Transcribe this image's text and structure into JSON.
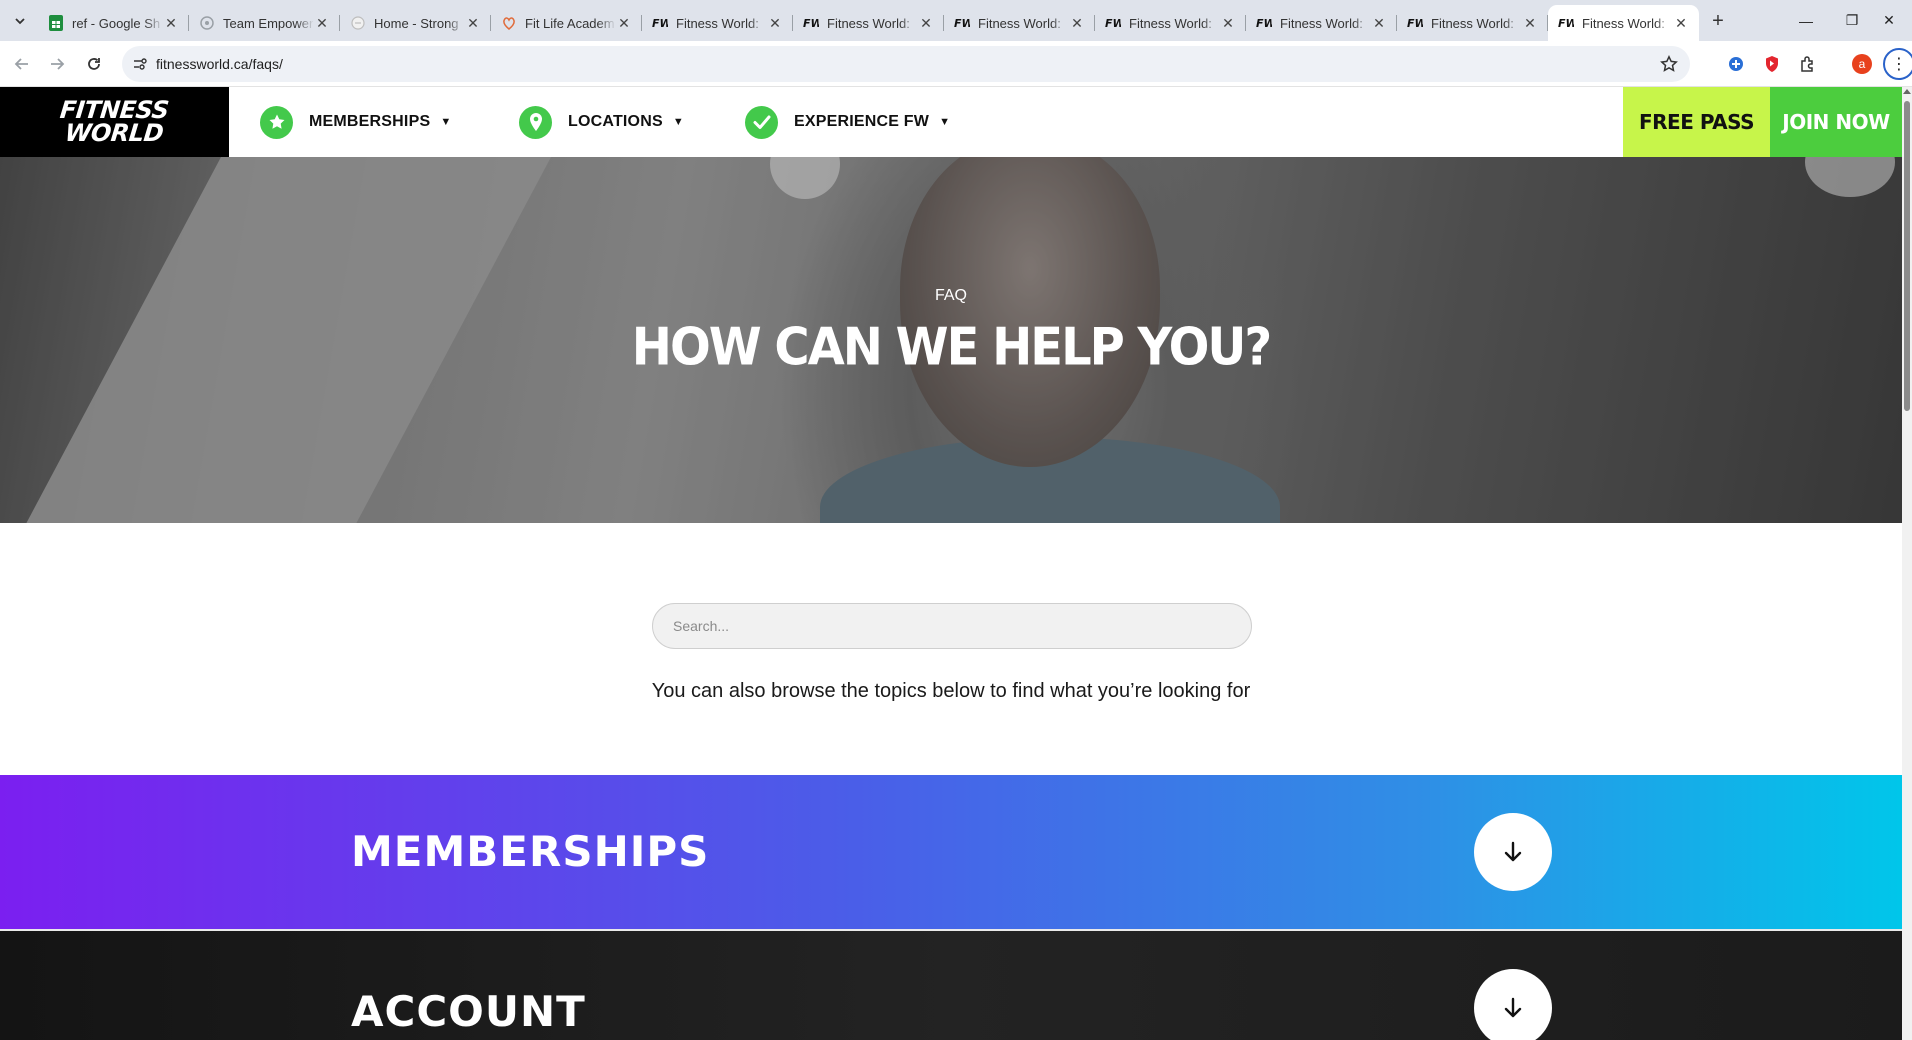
{
  "browser": {
    "tabs": [
      {
        "title": "ref - Google Sh",
        "favicon": "google-sheets-icon",
        "color": "#1e8e3e"
      },
      {
        "title": "Team Empower",
        "favicon": "team-empower-icon",
        "color": "#9aa0a6"
      },
      {
        "title": "Home - Strong",
        "favicon": "strong-icon",
        "color": "#bdbdbd"
      },
      {
        "title": "Fit Life Academ",
        "favicon": "fit-life-icon",
        "color": "#e06b3a"
      },
      {
        "title": "Fitness World:",
        "favicon": "fw-icon"
      },
      {
        "title": "Fitness World:",
        "favicon": "fw-icon"
      },
      {
        "title": "Fitness World:",
        "favicon": "fw-icon"
      },
      {
        "title": "Fitness World:",
        "favicon": "fw-icon"
      },
      {
        "title": "Fitness World:",
        "favicon": "fw-icon"
      },
      {
        "title": "Fitness World:",
        "favicon": "fw-icon"
      },
      {
        "title": "Fitness World:",
        "favicon": "fw-icon",
        "active": true
      }
    ],
    "close_glyph": "✕",
    "new_tab_glyph": "+",
    "url": "fitnessworld.ca/faqs/",
    "profile_initial": "a",
    "window_controls": {
      "minimize": "—",
      "restore": "❐",
      "close": "✕"
    }
  },
  "site": {
    "logo": {
      "line1": "FITNESS",
      "line2": "WORLD"
    },
    "menu": [
      {
        "label": "MEMBERSHIPS",
        "icon": "star-icon"
      },
      {
        "label": "LOCATIONS",
        "icon": "location-pin-icon"
      },
      {
        "label": "EXPERIENCE FW",
        "icon": "checkmark-icon"
      }
    ],
    "caret": "▼",
    "free_pass": "FREE PASS",
    "join_now": "JOIN NOW",
    "colors": {
      "accent_green": "#4ccd3e",
      "lime": "#c7f54a",
      "icon_green": "#43c94b"
    }
  },
  "hero": {
    "eyebrow": "FAQ",
    "title": "HOW CAN WE HELP YOU?"
  },
  "search": {
    "placeholder": "Search..."
  },
  "browse_text": "You can also browse the topics below to find what you’re looking for",
  "faq_sections": [
    {
      "title": "MEMBERSHIPS",
      "toggle_icon": "arrow-down-icon",
      "gradient": [
        "#7b1ff0",
        "#00c6ea"
      ]
    },
    {
      "title": "ACCOUNT",
      "toggle_icon": "arrow-down-icon",
      "gradient": [
        "#141414",
        "#232323"
      ]
    }
  ]
}
